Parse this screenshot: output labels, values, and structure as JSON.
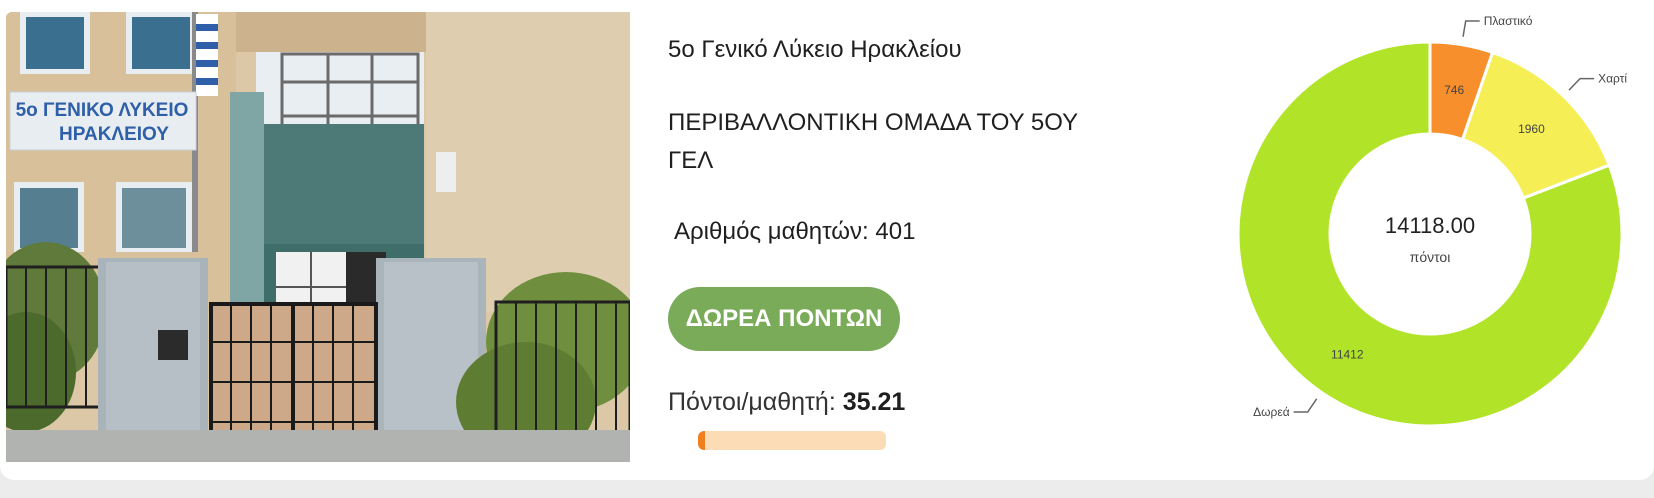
{
  "school": {
    "name": "5ο Γενικό Λύκειο Ηρακλείου",
    "group": "ΠΕΡΙΒΑΛΛΟΝΤΙΚΗ ΟΜΑΔΑ ΤΟΥ 5ΟΥ ΓΕΛ",
    "students_label": "Αριθμός μαθητών:",
    "students_count": "401",
    "donate_label": "ΔΩΡΕΑ ΠΟΝΤΩΝ",
    "points_per_student_label": "Πόντοι/μαθητή:",
    "points_per_student_value": "35.21",
    "points_progress_fraction": 0.035
  },
  "photo": {
    "sign_line1": "5ο ΓΕΝΙΚΟ ΛΥΚΕΙΟ",
    "sign_line2": "ΗΡΑΚΛΕΙΟΥ"
  },
  "chart_data": {
    "type": "pie",
    "donut": true,
    "center_value": "14118.00",
    "center_label": "πόντοι",
    "slices": [
      {
        "name": "Πλαστικό",
        "value": 746,
        "color": "#f68f2c"
      },
      {
        "name": "Χαρτί",
        "value": 1960,
        "color": "#f5ef55"
      },
      {
        "name": "Δωρεά",
        "value": 11412,
        "color": "#b1e428"
      }
    ]
  }
}
